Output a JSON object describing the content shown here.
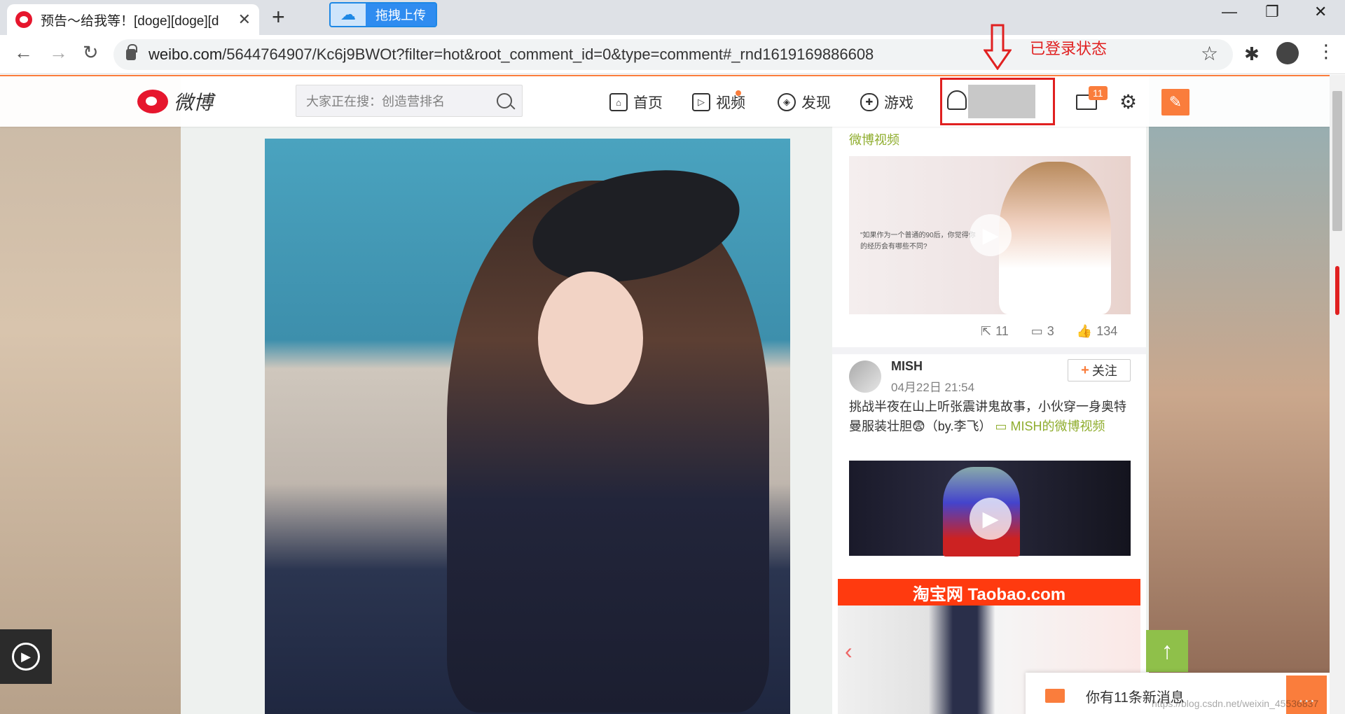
{
  "browser": {
    "tab_title": "预告～给我等！[doge][doge][d",
    "new_tab": "+",
    "extension_label": "拖拽上传",
    "url_host": "weibo.com",
    "url_rest": "/5644764907/Kc6j9BWOt?filter=hot&root_comment_id=0&type=comment#_rnd1619169886608"
  },
  "weibo": {
    "logo_text": "微博",
    "search_placeholder": "大家正在搜：创造营排名",
    "nav": [
      {
        "label": "首页",
        "icon": "home-icon"
      },
      {
        "label": "视频",
        "icon": "video-icon"
      },
      {
        "label": "发现",
        "icon": "compass-icon"
      },
      {
        "label": "游戏",
        "icon": "gamepad-icon"
      }
    ],
    "mail_badge": "11",
    "annotation": "已登录状态"
  },
  "sidebar": {
    "video_link": "微博视频",
    "thumb_quote": "\"如果作为一个普通的90后，你觉得你的经历会有哪些不同?",
    "stats": {
      "reposts": "11",
      "comments": "3",
      "likes": "134"
    },
    "post": {
      "author": "MISH",
      "time": "04月22日 21:54",
      "follow": "关注",
      "text": "挑战半夜在山上听张震讲鬼故事，小伙穿一身奥特曼服装壮胆😨（by.李飞）",
      "link": "MISH的微博视频"
    },
    "ad_title": "淘宝网 Taobao.com"
  },
  "notification": {
    "text": "你有11条新消息"
  },
  "watermark": "https://blog.csdn.net/weixin_45536837"
}
